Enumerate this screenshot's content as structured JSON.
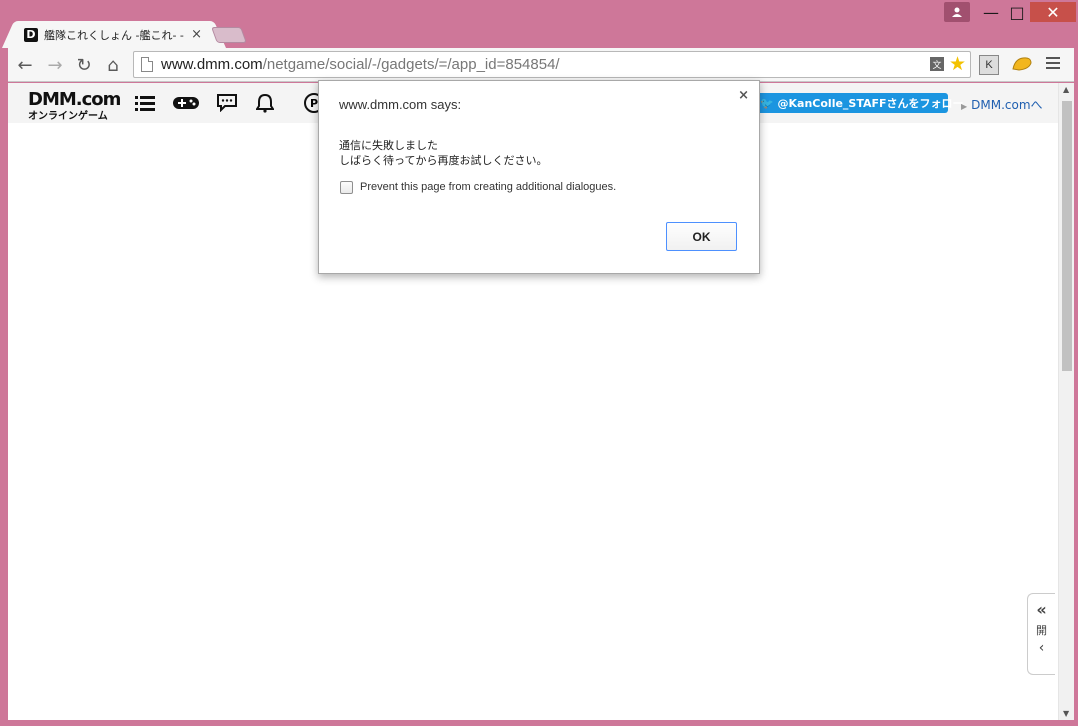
{
  "window": {
    "min_glyph": "—",
    "max_glyph": "□",
    "close_glyph": "✕"
  },
  "tab": {
    "favicon_letter": "D",
    "title": "艦隊これくしょん -艦これ- - オ",
    "close_glyph": "×"
  },
  "toolbar": {
    "back_glyph": "←",
    "forward_glyph": "→",
    "reload_glyph": "↻",
    "home_glyph": "⌂",
    "url_host": "www.dmm.com",
    "url_path": "/netgame/social/-/gadgets/=/app_id=854854/",
    "translate_glyph": "文",
    "star_glyph": "★",
    "ext_k_label": "K"
  },
  "dmm_bar": {
    "logo_main": "DMM.com",
    "logo_sub": "オンラインゲーム",
    "point_label": "P",
    "follow_button": "🐦 @KanColle_STAFFさんをフォロー",
    "dmm_link_arrow": "▶",
    "dmm_link": "DMM.comへ"
  },
  "side_tab": {
    "top_glyph": "«",
    "label": "開",
    "bottom_glyph": "‹"
  },
  "scrollbar": {
    "up_glyph": "▲",
    "down_glyph": "▼"
  },
  "dialog": {
    "title": "www.dmm.com says:",
    "close_glyph": "×",
    "message_line1": "通信に失敗しました",
    "message_line2": "しばらく待ってから再度お試しください。",
    "checkbox_label": "Prevent this page from creating additional dialogues.",
    "ok_label": "OK"
  },
  "colors": {
    "frame": "#ce7799",
    "close_button": "#c7504a",
    "follow_button": "#1b95e0",
    "link": "#1f5fb0",
    "ok_border": "#4d90fe"
  }
}
